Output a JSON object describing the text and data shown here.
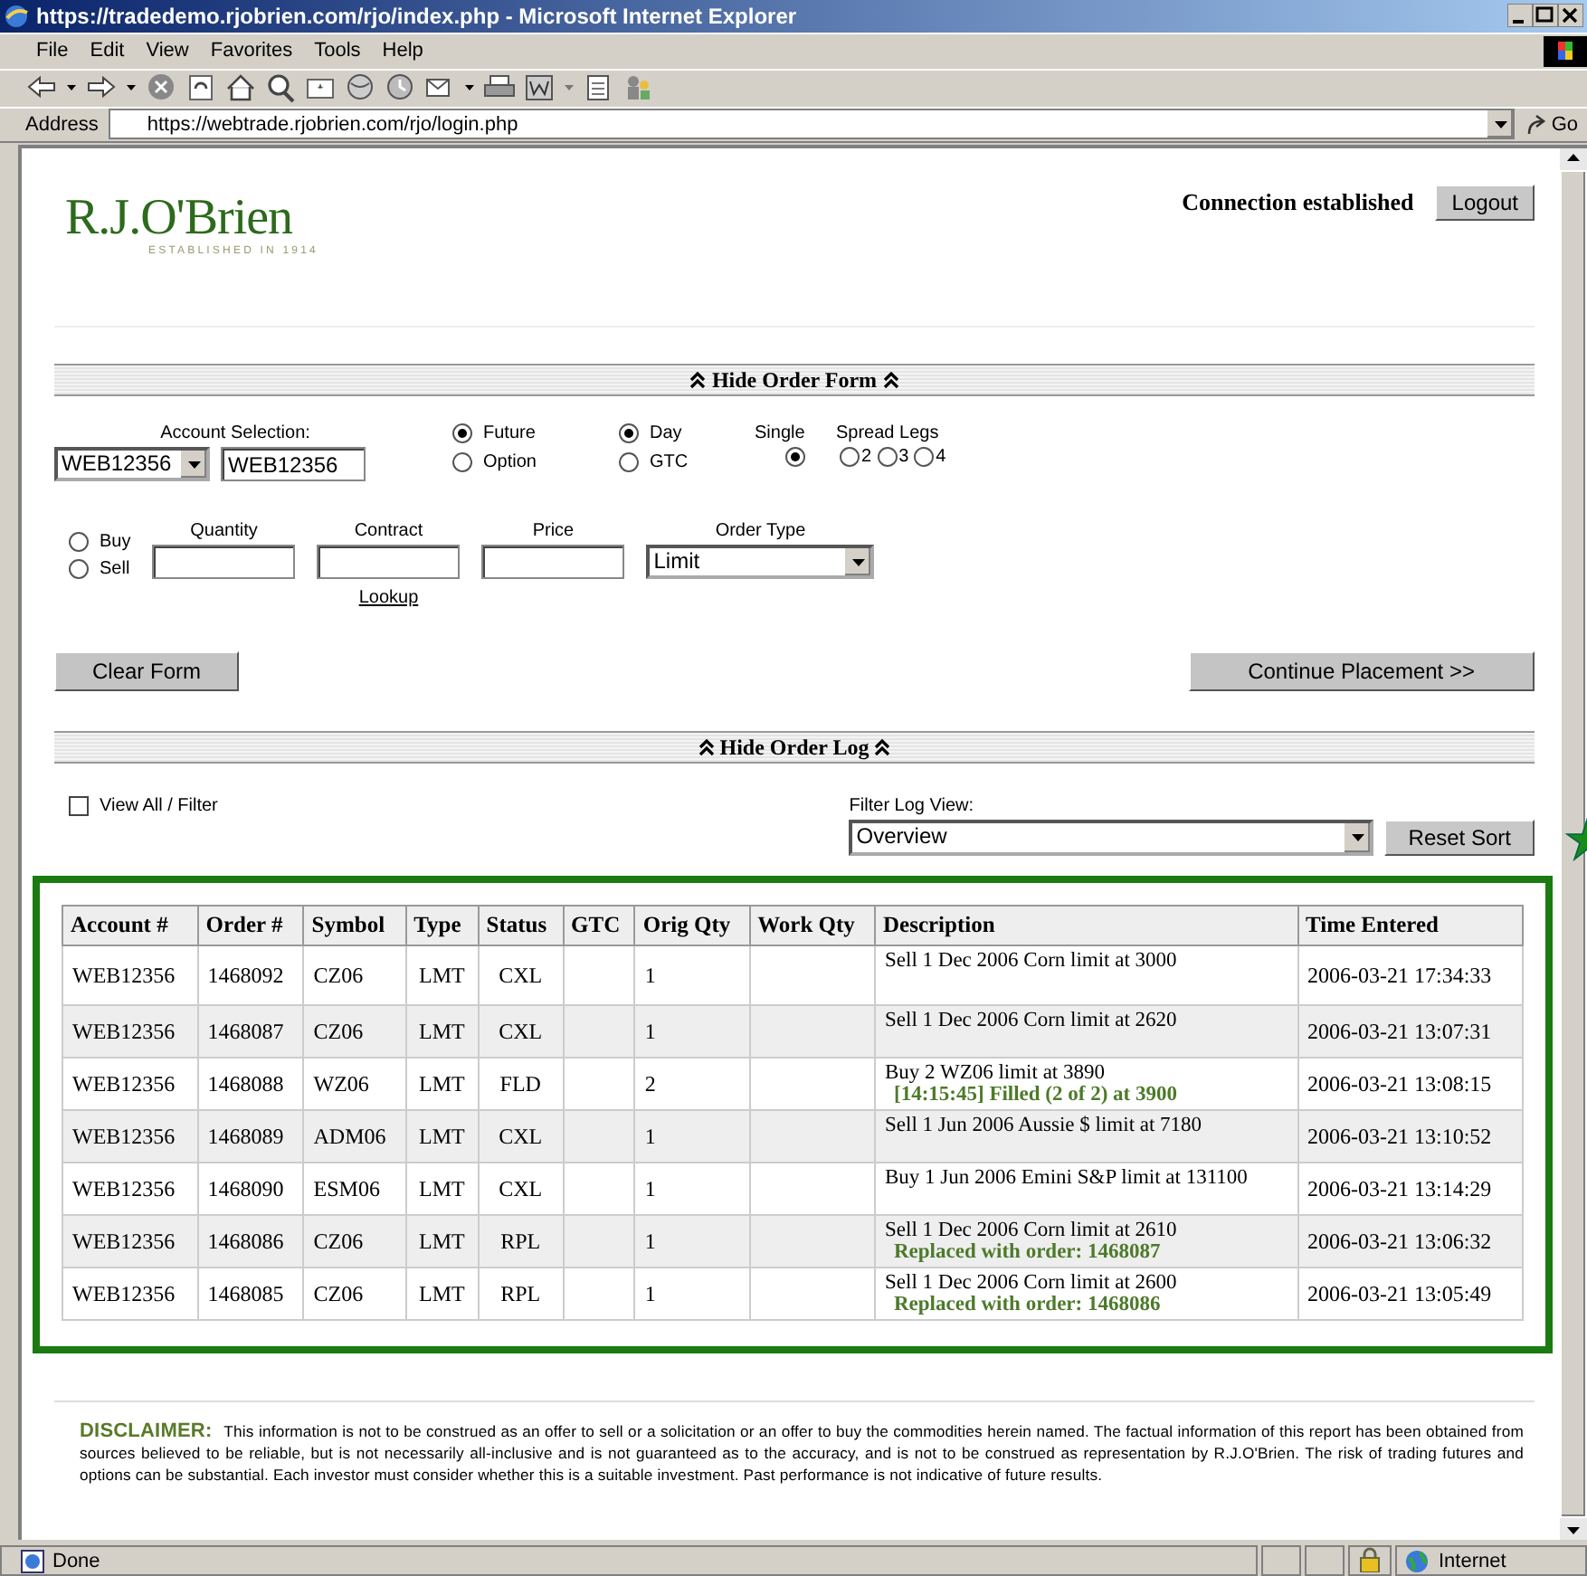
{
  "window": {
    "title": "https://tradedemo.rjobrien.com/rjo/index.php - Microsoft Internet Explorer",
    "menu": [
      "File",
      "Edit",
      "View",
      "Favorites",
      "Tools",
      "Help"
    ],
    "address_label": "Address",
    "address": "https://webtrade.rjobrien.com/rjo/login.php",
    "go_label": "Go"
  },
  "header": {
    "logo": "R.J.O'Brien",
    "tagline": "ESTABLISHED IN 1914",
    "connection": "Connection established",
    "logout": "Logout"
  },
  "order_form": {
    "toggle": "Hide Order Form",
    "account_label": "Account Selection:",
    "account_select": "WEB12356",
    "account_field": "WEB12356",
    "instrument": [
      {
        "label": "Future",
        "selected": true
      },
      {
        "label": "Option",
        "selected": false
      }
    ],
    "duration": [
      {
        "label": "Day",
        "selected": true
      },
      {
        "label": "GTC",
        "selected": false
      }
    ],
    "single": {
      "label": "Single",
      "selected": true
    },
    "spread_legs": {
      "label": "Spread Legs",
      "options": [
        {
          "label": "2",
          "selected": false
        },
        {
          "label": "3",
          "selected": false
        },
        {
          "label": "4",
          "selected": false
        }
      ]
    },
    "side": [
      {
        "label": "Buy",
        "selected": false
      },
      {
        "label": "Sell",
        "selected": false
      }
    ],
    "fields": [
      {
        "label": "Quantity"
      },
      {
        "label": "Contract",
        "link": "Lookup"
      },
      {
        "label": "Price"
      }
    ],
    "order_type": {
      "label": "Order Type",
      "value": "Limit"
    },
    "clear_button": "Clear Form",
    "continue_button": "Continue Placement >>"
  },
  "order_log": {
    "toggle": "Hide Order Log",
    "view_all": {
      "label": "View All / Filter",
      "checked": false
    },
    "filter_label": "Filter Log View:",
    "filter_value": "Overview",
    "reset_button": "Reset Sort",
    "columns": [
      "Account #",
      "Order #",
      "Symbol",
      "Type",
      "Status",
      "GTC",
      "Orig Qty",
      "Work Qty",
      "Description",
      "Time Entered"
    ],
    "rows": [
      {
        "cells": [
          "WEB12356",
          "1468092",
          "CZ06",
          "LMT",
          "CXL",
          "",
          "1",
          "",
          "Sell 1 Dec 2006 Corn limit at 3000",
          "2006-03-21 17:34:33"
        ]
      },
      {
        "cells": [
          "WEB12356",
          "1468087",
          "CZ06",
          "LMT",
          "CXL",
          "",
          "1",
          "",
          "Sell 1 Dec 2006 Corn limit at 2620",
          "2006-03-21 13:07:31"
        ]
      },
      {
        "cells": [
          "WEB12356",
          "1468088",
          "WZ06",
          "LMT",
          "FLD",
          "",
          "2",
          "",
          "Buy 2 WZ06 limit at 3890",
          "2006-03-21 13:08:15"
        ],
        "note": "[14:15:45]  Filled (2 of 2) at 3900"
      },
      {
        "cells": [
          "WEB12356",
          "1468089",
          "ADM06",
          "LMT",
          "CXL",
          "",
          "1",
          "",
          "Sell 1 Jun 2006 Aussie $ limit at 7180",
          "2006-03-21 13:10:52"
        ]
      },
      {
        "cells": [
          "WEB12356",
          "1468090",
          "ESM06",
          "LMT",
          "CXL",
          "",
          "1",
          "",
          "Buy 1 Jun 2006 Emini S&P limit at 131100",
          "2006-03-21 13:14:29"
        ]
      },
      {
        "cells": [
          "WEB12356",
          "1468086",
          "CZ06",
          "LMT",
          "RPL",
          "",
          "1",
          "",
          "Sell 1 Dec 2006 Corn limit at 2610",
          "2006-03-21 13:06:32"
        ],
        "note": "Replaced with order: 1468087"
      },
      {
        "cells": [
          "WEB12356",
          "1468085",
          "CZ06",
          "LMT",
          "RPL",
          "",
          "1",
          "",
          "Sell 1 Dec 2006 Corn limit at 2600",
          "2006-03-21 13:05:49"
        ],
        "note": "Replaced with order: 1468086"
      }
    ]
  },
  "disclaimer": {
    "text": "**DISCLAIMER:** This information is not to be construed as an offer to sell or a solicitation or an offer to buy the commodities herein named. The factual information of this report has been obtained from sources believed to be reliable, but is not necessarily all-inclusive and is not guaranteed as to the accuracy, and is not to be construed as representation by R.J.O'Brien. The risk of trading futures and options can be substantial. Each investor must consider whether this is a suitable investment. Past performance is not indicative of future results."
  },
  "status_bar": {
    "text": "Done",
    "zone": "Internet"
  }
}
